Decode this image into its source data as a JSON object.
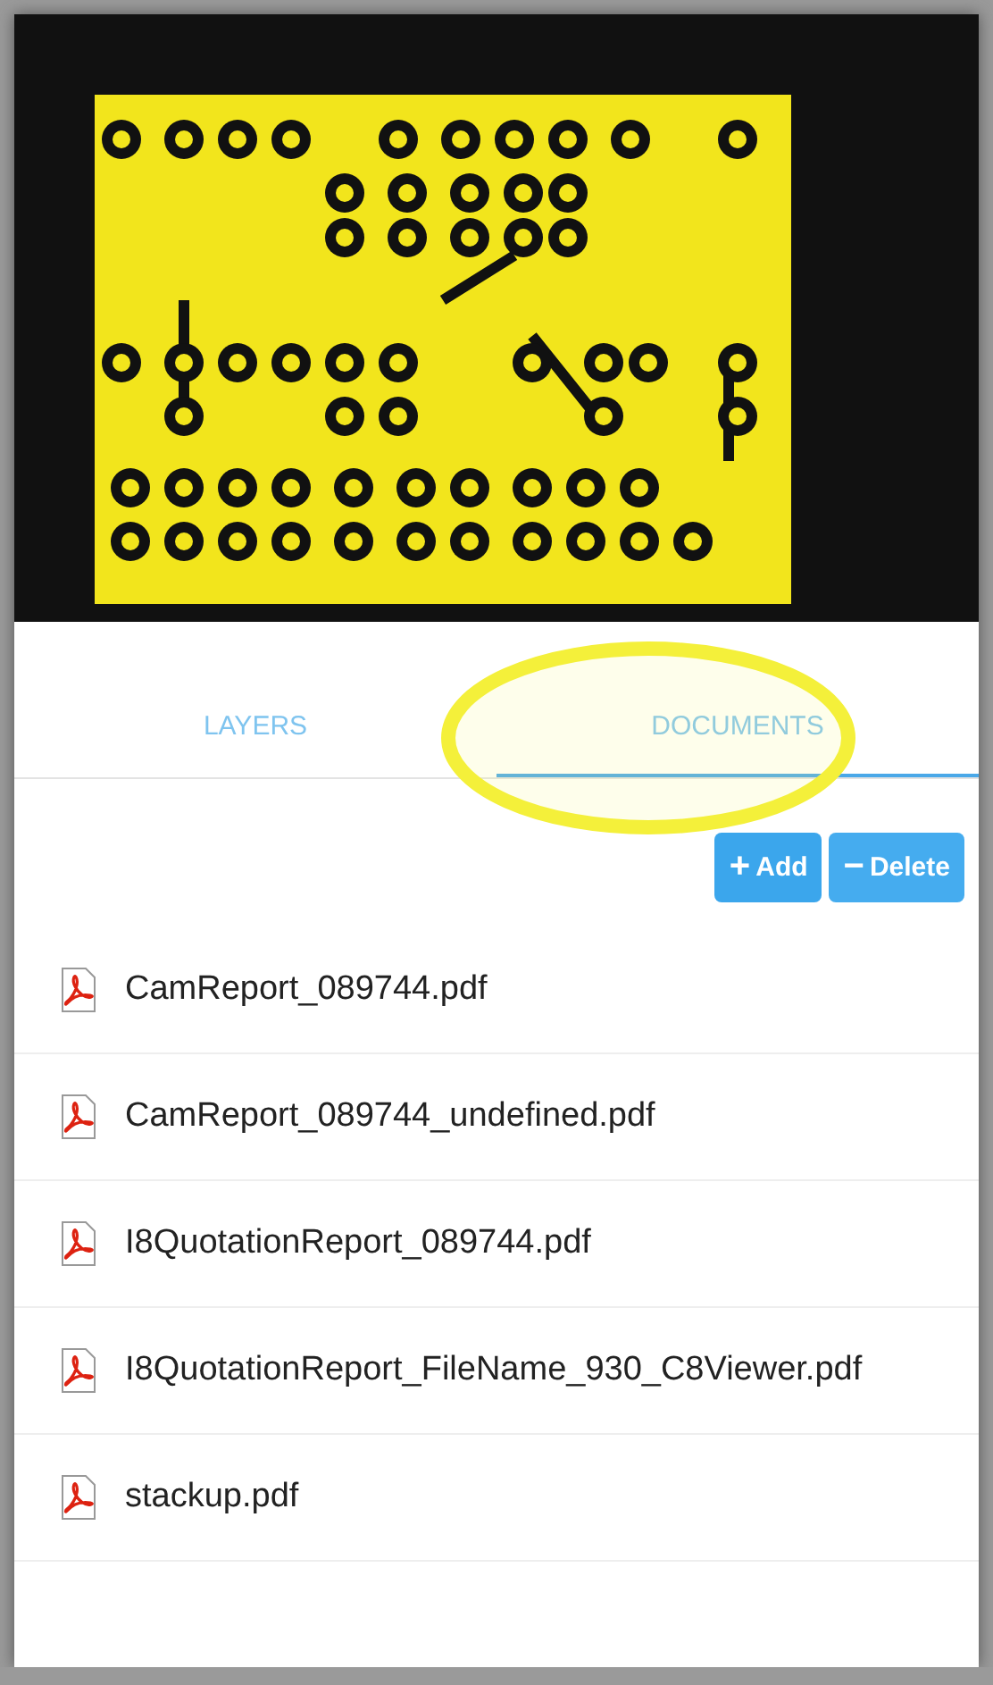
{
  "tabs": [
    {
      "label": "LAYERS",
      "selected": false,
      "highlighted": false
    },
    {
      "label": "DOCUMENTS",
      "selected": true,
      "highlighted": true
    }
  ],
  "actions": [
    {
      "kind": "add",
      "icon": "+",
      "label": "Add"
    },
    {
      "kind": "delete",
      "icon": "−",
      "label": "Delete"
    }
  ],
  "documents": [
    {
      "name": "CamReport_089744.pdf"
    },
    {
      "name": "CamReport_089744_undefined.pdf"
    },
    {
      "name": "I8QuotationReport_089744.pdf"
    },
    {
      "name": "I8QuotationReport_FileName_930_C8Viewer.pdf"
    },
    {
      "name": "stackup.pdf"
    }
  ]
}
